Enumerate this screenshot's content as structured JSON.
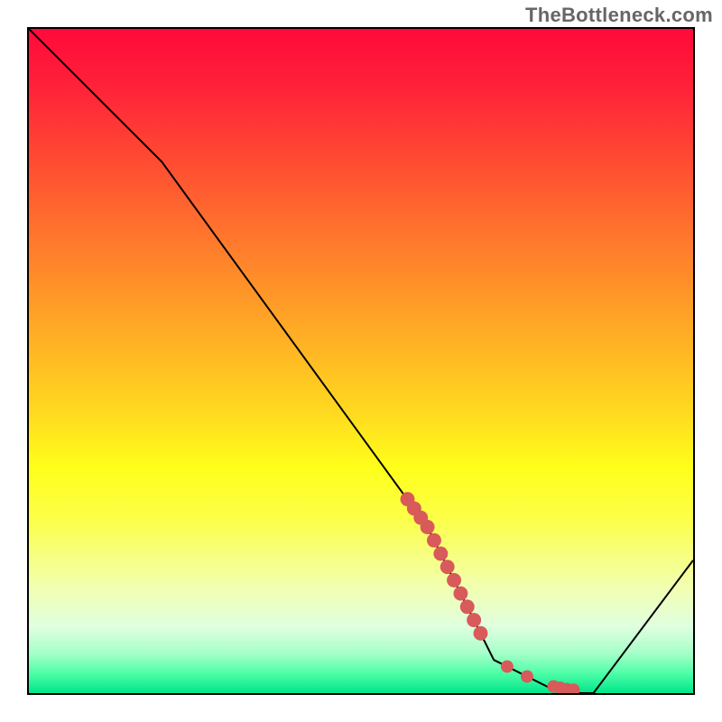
{
  "watermark": "TheBottleneck.com",
  "chart_data": {
    "type": "line",
    "title": "",
    "xlabel": "",
    "ylabel": "",
    "xlim": [
      0,
      100
    ],
    "ylim": [
      0,
      100
    ],
    "series": [
      {
        "name": "curve",
        "x": [
          0,
          20,
          60,
          70,
          80,
          85,
          100
        ],
        "y": [
          100,
          80,
          25,
          5,
          0,
          0,
          20
        ]
      }
    ],
    "markers": {
      "name": "dots",
      "color": "#d85a5a",
      "x": [
        57,
        58,
        59,
        60,
        61,
        62,
        63,
        64,
        65,
        66,
        67,
        68,
        72,
        75,
        79,
        80,
        81,
        82
      ],
      "y": [
        29.2,
        27.8,
        26.4,
        25.0,
        23.0,
        21.0,
        19.0,
        17.0,
        15.0,
        13.0,
        11.0,
        9.0,
        4.0,
        2.5,
        1.0,
        0.8,
        0.6,
        0.5
      ]
    },
    "gradient_stops": [
      {
        "pos": 0,
        "color": "#ff0a3a"
      },
      {
        "pos": 66,
        "color": "#ffff1a"
      },
      {
        "pos": 100,
        "color": "#00e58a"
      }
    ]
  }
}
